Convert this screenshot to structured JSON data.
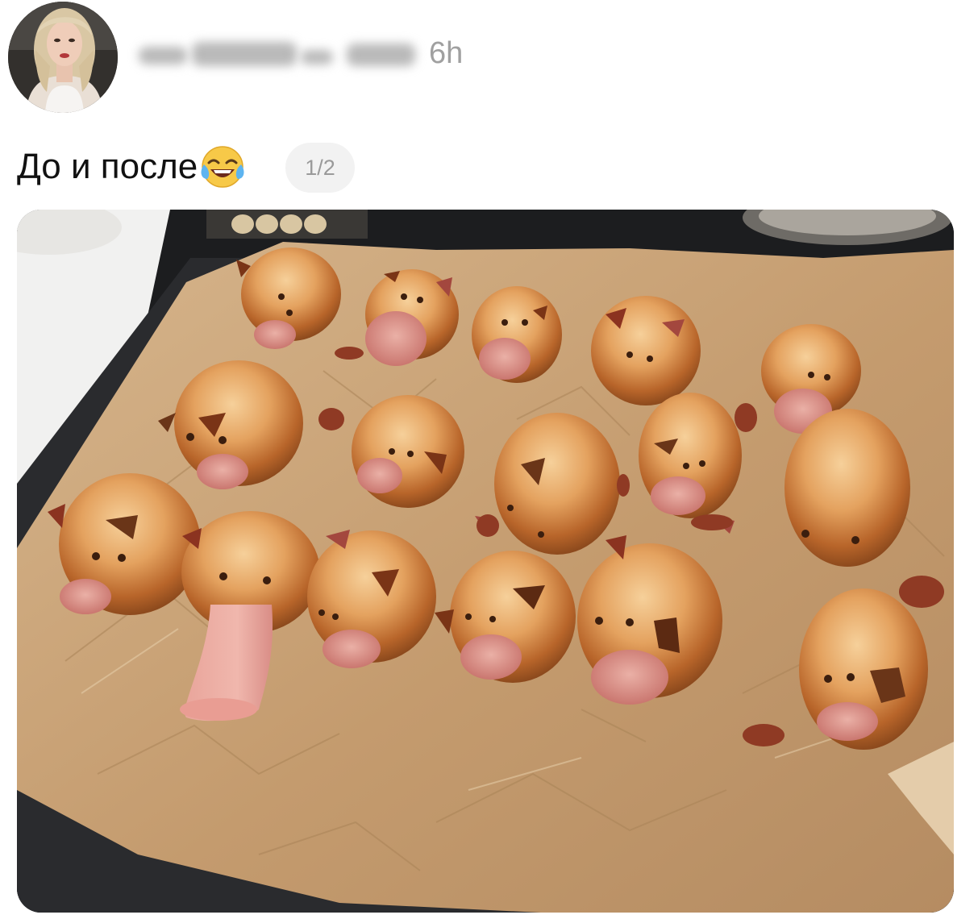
{
  "post": {
    "timestamp": "6h",
    "caption_text": "До и после",
    "caption_emoji": "face-with-tears-of-joy",
    "slide_counter": "1/2"
  },
  "colors": {
    "timestamp": "#a0a0a0",
    "counter_bg": "#f2f2f2",
    "counter_text": "#9a9a9a",
    "paper": "#c9a57d",
    "bun": "#e3a060",
    "sausage": "#d98d86"
  },
  "icons": {
    "emoji": "face-with-tears-of-joy-icon"
  }
}
